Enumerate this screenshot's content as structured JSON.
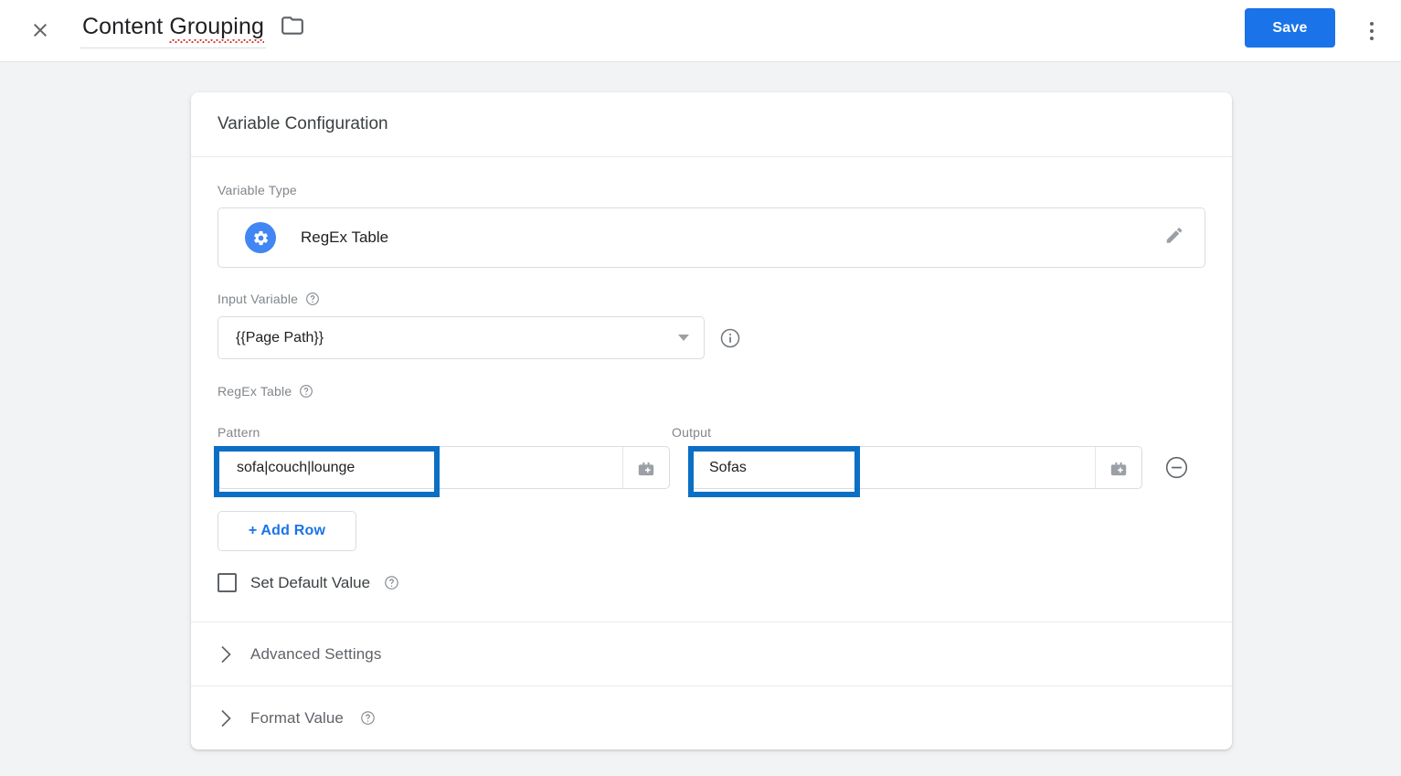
{
  "topbar": {
    "close_icon": "close-icon",
    "title_prefix": "Content ",
    "title_misspelled_word": "Grouping",
    "folder_icon": "folder-icon",
    "save_label": "Save",
    "overflow_icon": "more-vert-icon",
    "save_color": "#1a73e8"
  },
  "card": {
    "header": "Variable Configuration",
    "variable_type": {
      "label": "Variable Type",
      "name": "RegEx Table",
      "icon": "gear-icon",
      "icon_color": "#4285f4",
      "edit_icon": "pencil-icon"
    },
    "input_variable": {
      "label": "Input Variable",
      "help_icon": "help-circle-icon",
      "value": "{{Page Path}}",
      "dropdown_icon": "chevron-down-icon",
      "info_icon": "info-circle-icon"
    },
    "regex_table": {
      "label": "RegEx Table",
      "help_icon": "help-circle-icon",
      "columns": [
        "Pattern",
        "Output"
      ],
      "rows": [
        {
          "pattern": "sofa|couch|lounge",
          "output": "Sofas",
          "pattern_variable_icon": "insert-variable-icon",
          "output_variable_icon": "insert-variable-icon",
          "remove_icon": "remove-circle-icon"
        }
      ],
      "add_row_label": "+ Add Row"
    },
    "set_default_value": {
      "label": "Set Default Value",
      "checked": false,
      "help_icon": "help-circle-icon"
    },
    "sections": [
      {
        "title": "Advanced Settings",
        "expand_icon": "chevron-right-icon",
        "has_help": false
      },
      {
        "title": "Format Value",
        "expand_icon": "chevron-right-icon",
        "has_help": true
      }
    ]
  },
  "annotations": {
    "color": "#0b6fc4",
    "boxes": [
      "pattern-field-highlight",
      "output-field-highlight"
    ]
  }
}
